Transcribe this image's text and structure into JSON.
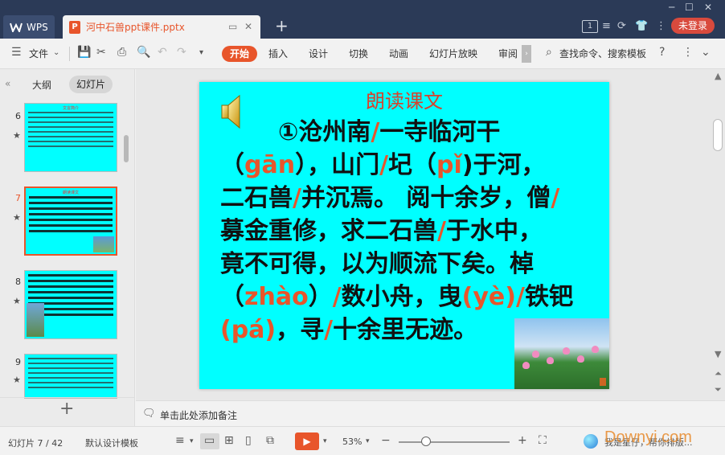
{
  "tabs": {
    "app_label": "WPS",
    "document_label": "河中石兽ppt课件.pptx"
  },
  "titlebar": {
    "page_count_badge": "1",
    "login_label": "未登录"
  },
  "ribbon": {
    "file_label": "文件",
    "items": [
      "开始",
      "插入",
      "设计",
      "切换",
      "动画",
      "幻灯片放映",
      "审阅"
    ],
    "search_label": "查找命令、搜索模板"
  },
  "left_panel": {
    "tab_outline": "大纲",
    "tab_slides": "幻灯片",
    "thumbnails": [
      {
        "number": "6",
        "title": "文言简介"
      },
      {
        "number": "7",
        "title": "朗读课文"
      },
      {
        "number": "8",
        "title": ""
      },
      {
        "number": "9",
        "title": ""
      }
    ]
  },
  "slide": {
    "title": "朗读课文",
    "line1_a": "①沧州南",
    "line1_b": "一寺临河干",
    "line2_a": "（",
    "line2_py1": "gān",
    "line2_b": "），山门",
    "line2_c": "圮（",
    "line2_py2": "pǐ",
    "line2_d": ")于河，",
    "line3_a": "二石兽",
    "line3_b": "并沉焉。 阅十余岁，僧",
    "line4_a": "募金重修，求二石兽",
    "line4_b": "于水中，",
    "line5": "竟不可得，以为顺流下矣。棹",
    "line6_a": "（",
    "line6_py": "zhào",
    "line6_b": "）",
    "line6_c": "数小舟，曳",
    "line6_py2": "(yè)",
    "line6_d": "铁钯",
    "line7_py": "(pá)",
    "line7_a": "，寻",
    "line7_b": "十余里无迹。",
    "slash": "/"
  },
  "notes": {
    "placeholder": "单击此处添加备注"
  },
  "status": {
    "slide_position": "幻灯片 7 / 42",
    "template": "默认设计模板",
    "zoom": "53%",
    "ai_text": "我是星仔，帮你排版...",
    "watermark": "Downyi.com"
  },
  "colors": {
    "accent": "#e8552b",
    "slide_bg": "#00ffff",
    "titlebar": "#2b3a57"
  }
}
